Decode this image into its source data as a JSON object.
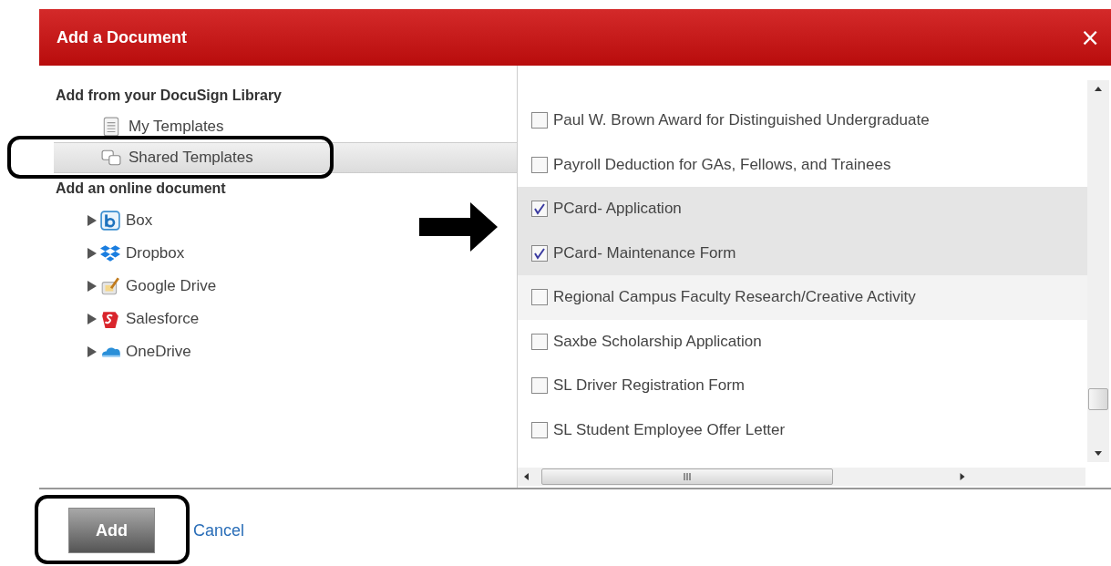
{
  "dialog": {
    "title": "Add a Document",
    "close": "×"
  },
  "library": {
    "heading": "Add from your DocuSign Library",
    "items": [
      {
        "label": "My Templates",
        "kind": "document",
        "selected": false
      },
      {
        "label": "Shared Templates",
        "kind": "shared",
        "selected": true
      }
    ]
  },
  "online": {
    "heading": "Add an online document",
    "items": [
      {
        "label": "Box",
        "kind": "box",
        "expanded": false
      },
      {
        "label": "Dropbox",
        "kind": "dropbox",
        "expanded": false
      },
      {
        "label": "Google Drive",
        "kind": "gdrive",
        "expanded": false
      },
      {
        "label": "Salesforce",
        "kind": "salesforce",
        "expanded": false
      },
      {
        "label": "OneDrive",
        "kind": "onedrive",
        "expanded": false
      }
    ]
  },
  "templates": [
    {
      "label": "Paul W. Brown Award for Distinguished Undergraduate",
      "checked": false,
      "hovered": false
    },
    {
      "label": "Payroll Deduction for GAs, Fellows, and Trainees",
      "checked": false,
      "hovered": false
    },
    {
      "label": "PCard- Application",
      "checked": true,
      "hovered": false
    },
    {
      "label": "PCard- Maintenance Form",
      "checked": true,
      "hovered": false
    },
    {
      "label": "Regional Campus Faculty Research/Creative Activity",
      "checked": false,
      "hovered": true
    },
    {
      "label": "Saxbe Scholarship Application",
      "checked": false,
      "hovered": false
    },
    {
      "label": "SL Driver Registration Form",
      "checked": false,
      "hovered": false
    },
    {
      "label": "SL Student Employee Offer Letter",
      "checked": false,
      "hovered": false
    }
  ],
  "buttons": {
    "add": "Add",
    "cancel": "Cancel"
  }
}
